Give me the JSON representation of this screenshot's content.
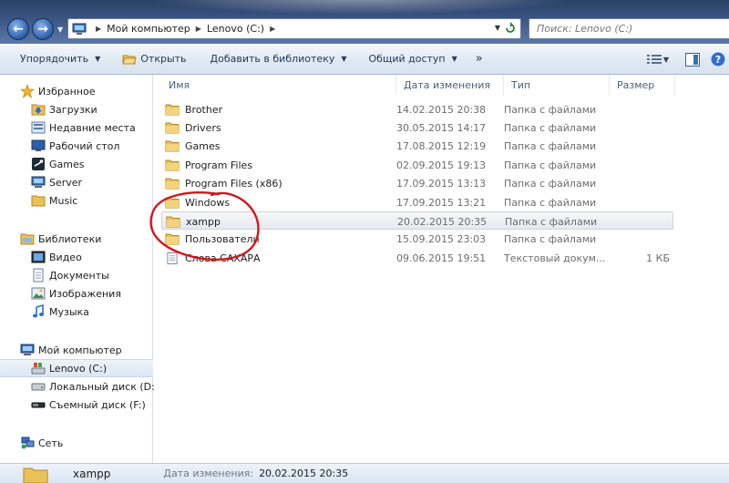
{
  "address": {
    "crumbs": [
      "Мой компьютер",
      "Lenovo (C:)"
    ]
  },
  "search": {
    "placeholder": "Поиск: Lenovo (C:)"
  },
  "toolbar": {
    "organize": "Упорядочить",
    "open": "Открыть",
    "add_library": "Добавить в библиотеку",
    "share": "Общий доступ",
    "more": "»"
  },
  "nav": {
    "favorites": "Избранное",
    "favorites_items": [
      "Загрузки",
      "Недавние места",
      "Рабочий стол",
      "Games",
      "Server",
      "Music"
    ],
    "libraries": "Библиотеки",
    "library_items": [
      "Видео",
      "Документы",
      "Изображения",
      "Музыка"
    ],
    "computer": "Мой компьютер",
    "computer_items": [
      "Lenovo (C:)",
      "Локальный диск  (D:)",
      "Съемный диск (F:)"
    ],
    "network": "Сеть"
  },
  "columns": {
    "name": "Имя",
    "date": "Дата изменения",
    "type": "Тип",
    "size": "Размер"
  },
  "files": [
    {
      "name": "Brother",
      "date": "14.02.2015 20:38",
      "type": "Папка с файлами",
      "size": ""
    },
    {
      "name": "Drivers",
      "date": "30.05.2015 14:17",
      "type": "Папка с файлами",
      "size": ""
    },
    {
      "name": "Games",
      "date": "17.08.2015 12:19",
      "type": "Папка с файлами",
      "size": ""
    },
    {
      "name": "Program Files",
      "date": "02.09.2015 19:13",
      "type": "Папка с файлами",
      "size": ""
    },
    {
      "name": "Program Files (x86)",
      "date": "17.09.2015 13:13",
      "type": "Папка с файлами",
      "size": ""
    },
    {
      "name": "Windows",
      "date": "17.09.2015 13:21",
      "type": "Папка с файлами",
      "size": ""
    },
    {
      "name": "xampp",
      "date": "20.02.2015 20:35",
      "type": "Папка с файлами",
      "size": ""
    },
    {
      "name": "Пользователи",
      "date": "15.09.2015 23:03",
      "type": "Папка с файлами",
      "size": ""
    },
    {
      "name": "Слова САХАРА",
      "date": "09.06.2015 19:51",
      "type": "Текстовый докум...",
      "size": "1 КБ"
    }
  ],
  "details": {
    "name": "xampp",
    "date_label": "Дата изменения:",
    "date_value": "20.02.2015 20:35"
  },
  "colors": {
    "annotation": "#d8141a",
    "folder": "#e9c25a",
    "header_text": "#4c607a"
  }
}
